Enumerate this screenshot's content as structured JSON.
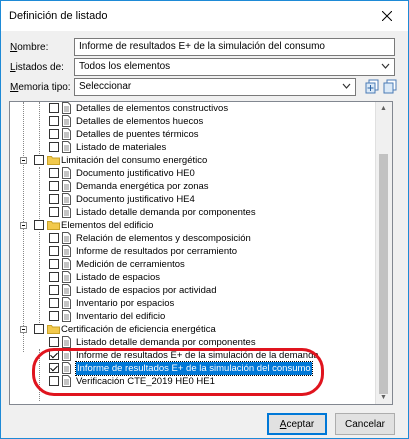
{
  "window": {
    "title": "Definición de listado"
  },
  "form": {
    "nombre_label_u": "N",
    "nombre_label_rest": "ombre:",
    "nombre_value": "Informe de resultados E+ de la simulación del consumo",
    "listados_label_u": "L",
    "listados_label_rest": "istados de:",
    "listados_value": "Todos los elementos",
    "memoria_label_u": "M",
    "memoria_label_rest": "emoria tipo:",
    "memoria_value": "Seleccionar"
  },
  "tree": {
    "items": [
      {
        "label": "Detalles de elementos constructivos",
        "checked": false
      },
      {
        "label": "Detalles de elementos huecos",
        "checked": false
      },
      {
        "label": "Detalles de puentes térmicos",
        "checked": false
      },
      {
        "label": "Listado de materiales",
        "checked": false
      },
      {
        "label": "Limitación del consumo energético",
        "checked": false,
        "group": true
      },
      {
        "label": "Documento justificativo HE0",
        "checked": false
      },
      {
        "label": "Demanda energética por zonas",
        "checked": false
      },
      {
        "label": "Documento justificativo HE4",
        "checked": false
      },
      {
        "label": "Listado detalle demanda por componentes",
        "checked": false
      },
      {
        "label": "Elementos del edificio",
        "checked": false,
        "group": true
      },
      {
        "label": "Relación de elementos y descomposición",
        "checked": false
      },
      {
        "label": "Informe de resultados por cerramiento",
        "checked": false
      },
      {
        "label": "Medición de cerramientos",
        "checked": false
      },
      {
        "label": "Listado de espacios",
        "checked": false
      },
      {
        "label": "Listado de espacios por actividad",
        "checked": false
      },
      {
        "label": "Inventario por espacios",
        "checked": false
      },
      {
        "label": "Inventario del edificio",
        "checked": false
      },
      {
        "label": "Certificación de eficiencia energética",
        "checked": false,
        "group": true
      },
      {
        "label": "Listado detalle demanda por componentes",
        "checked": false
      },
      {
        "label": "Informe de resultados E+ de la simulación de la demanda",
        "checked": true
      },
      {
        "label": "Informe de resultados E+ de la simulación del consumo",
        "checked": true,
        "selected": true
      },
      {
        "label": "Verificación CTE_2019 HE0 HE1",
        "checked": false
      }
    ]
  },
  "buttons": {
    "accept_u": "A",
    "accept_rest": "ceptar",
    "cancel": "Cancelar"
  },
  "colors": {
    "selection": "#0078d7",
    "annotation": "#e0141e",
    "folder": "#f2c94c"
  }
}
